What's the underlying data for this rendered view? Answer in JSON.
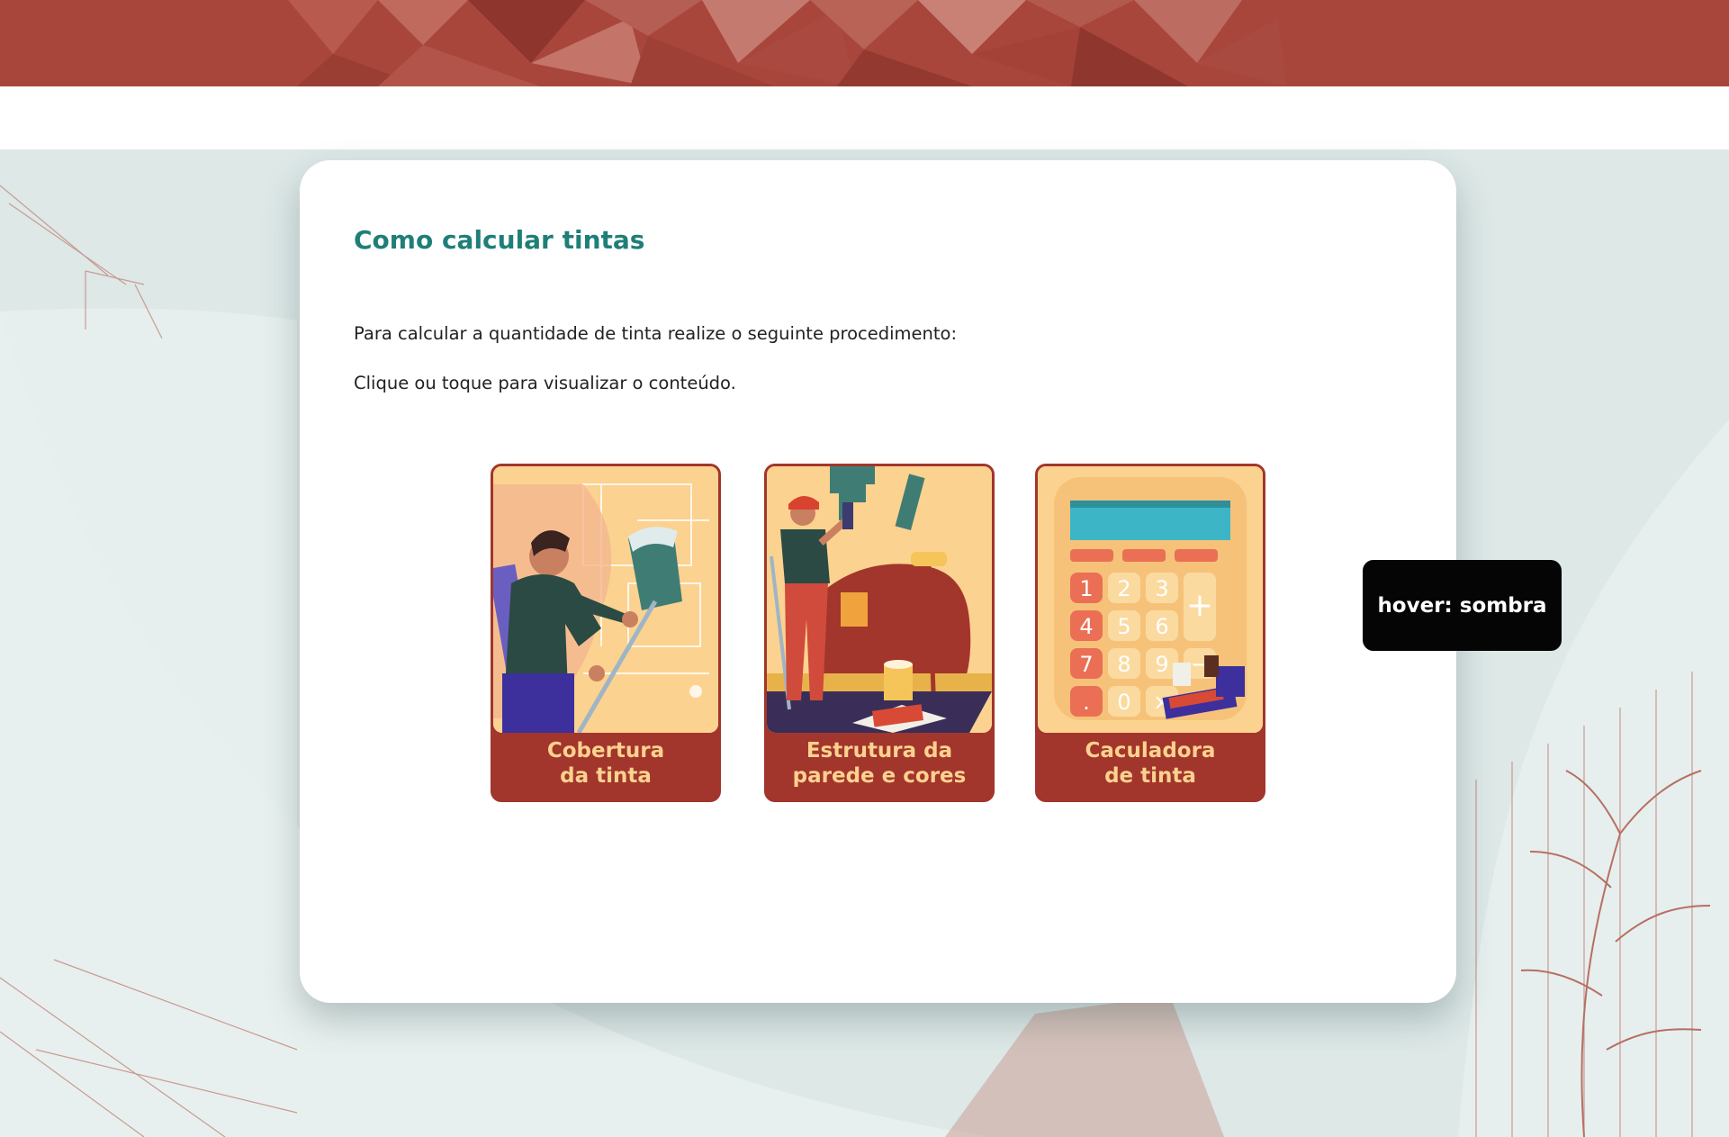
{
  "page": {
    "title": "Como calcular tintas",
    "intro": "Para calcular a quantidade de tinta realize o seguinte procedimento:",
    "instruction": "Clique ou toque para visualizar o conteúdo."
  },
  "tiles": [
    {
      "line1": "Cobertura",
      "line2": "da tinta",
      "icon": "painter-roller-icon"
    },
    {
      "line1": "Estrutura da",
      "line2": "parede e cores",
      "icon": "wall-painter-icon"
    },
    {
      "line1": "Caculadora",
      "line2": "de tinta",
      "icon": "calculator-icon"
    }
  ],
  "calculator_keys": [
    "1",
    "2",
    "3",
    "4",
    "5",
    "6",
    "7",
    "8",
    "9",
    ".",
    "0",
    "×",
    "+",
    "−"
  ],
  "tooltip": {
    "label": "hover: sombra"
  },
  "colors": {
    "banner": "#a8463b",
    "title": "#1f7f78",
    "tile_border": "#a2352c",
    "tile_caption": "#fbd28f",
    "background": "#dfe9e8"
  }
}
